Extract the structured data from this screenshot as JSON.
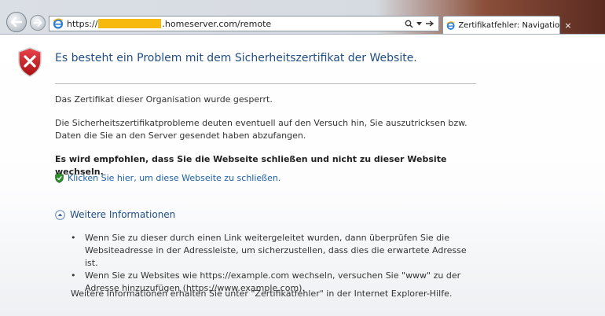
{
  "browser": {
    "url_prefix": "https://",
    "url_suffix": ".homeserver.com/remote",
    "tab_title": "Zertifikatfehler: Navigation ...",
    "tab_close": "×",
    "redaction_color": "#f8b90f"
  },
  "page": {
    "title": "Es besteht ein Problem mit dem Sicherheitszertifikat der Website.",
    "para1": "Das Zertifikat dieser Organisation wurde gesperrt.",
    "para2": "Die Sicherheitszertifikatprobleme deuten eventuell auf den Versuch hin, Sie auszutricksen bzw. Daten die Sie an den Server gesendet haben abzufangen.",
    "recommendation": "Es wird empfohlen, dass Sie die Webseite schließen und nicht zu dieser Website wechseln.",
    "close_link": "Klicken Sie hier, um diese Webseite zu schließen.",
    "more_info_label": "Weitere Informationen",
    "bullets": [
      "Wenn Sie zu dieser durch einen Link weitergeleitet wurden, dann überprüfen Sie die Websiteadresse in der Adressleiste, um sicherzustellen, dass dies die erwartete Adresse ist.",
      "Wenn Sie zu Websites wie https://example.com wechseln, versuchen Sie \"www\" zu der Adresse hinzuzufügen (https://www.example.com)."
    ],
    "bullet_char": "•",
    "help_note": "Weitere Informationen erhalten Sie unter \"Zertifikatfehler\" in der Internet Explorer-Hilfe."
  },
  "icons": {
    "back": "back-arrow-icon",
    "forward": "forward-arrow-icon",
    "ie": "internet-explorer-icon",
    "search": "search-icon",
    "dropdown": "dropdown-arrow-icon",
    "refresh": "refresh-icon",
    "shield": "error-shield-icon",
    "green_shield": "green-shield-icon",
    "expand": "collapse-up-icon"
  },
  "colors": {
    "title": "#1f4e86",
    "link": "#1a5ea3",
    "error_red": "#c4161c",
    "safe_green": "#2e8b2e"
  }
}
